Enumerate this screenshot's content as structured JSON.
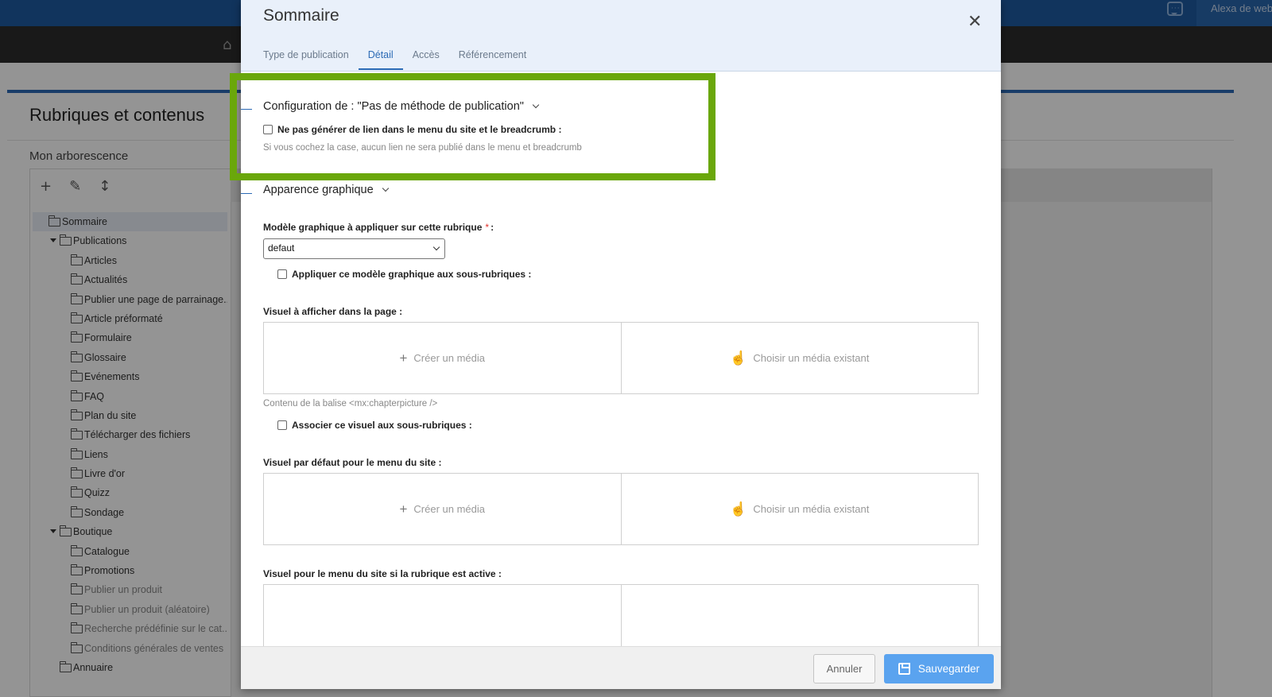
{
  "background": {
    "user_label": "Alexa de web",
    "page_title": "Rubriques et contenus",
    "tree_title": "Mon arborescence",
    "toolbar_icons": [
      "plus-icon",
      "pencil-icon",
      "move-icon"
    ],
    "tree": [
      {
        "label": "Sommaire",
        "level": 0,
        "selected": true,
        "expanded": false,
        "dim": false
      },
      {
        "label": "Publications",
        "level": 1,
        "expanded": true,
        "dim": false
      },
      {
        "label": "Articles",
        "level": 2,
        "dim": false
      },
      {
        "label": "Actualités",
        "level": 2,
        "dim": false
      },
      {
        "label": "Publier une page de parrainage...",
        "level": 2,
        "dim": false
      },
      {
        "label": "Article préformaté",
        "level": 2,
        "dim": false
      },
      {
        "label": "Formulaire",
        "level": 2,
        "dim": false
      },
      {
        "label": "Glossaire",
        "level": 2,
        "dim": false
      },
      {
        "label": "Evénements",
        "level": 2,
        "dim": false
      },
      {
        "label": "FAQ",
        "level": 2,
        "dim": false
      },
      {
        "label": "Plan du site",
        "level": 2,
        "dim": false
      },
      {
        "label": "Télécharger des fichiers",
        "level": 2,
        "dim": false
      },
      {
        "label": "Liens",
        "level": 2,
        "dim": false
      },
      {
        "label": "Livre d'or",
        "level": 2,
        "dim": false
      },
      {
        "label": "Quizz",
        "level": 2,
        "dim": false
      },
      {
        "label": "Sondage",
        "level": 2,
        "dim": false
      },
      {
        "label": "Boutique",
        "level": 1,
        "expanded": true,
        "dim": false
      },
      {
        "label": "Catalogue",
        "level": 2,
        "dim": false
      },
      {
        "label": "Promotions",
        "level": 2,
        "dim": false
      },
      {
        "label": "Publier un produit",
        "level": 2,
        "dim": true
      },
      {
        "label": "Publier un produit (aléatoire)",
        "level": 2,
        "dim": true
      },
      {
        "label": "Recherche prédéfinie sur le cat...",
        "level": 2,
        "dim": true
      },
      {
        "label": "Conditions générales de ventes",
        "level": 2,
        "dim": true
      },
      {
        "label": "Annuaire",
        "level": 1,
        "dim": false
      }
    ]
  },
  "modal": {
    "title": "Sommaire",
    "close_icon": "close-icon",
    "tabs": [
      {
        "label": "Type de publication",
        "active": false
      },
      {
        "label": "Détail",
        "active": true
      },
      {
        "label": "Accès",
        "active": false
      },
      {
        "label": "Référencement",
        "active": false
      }
    ],
    "config_section": {
      "title": "Configuration de : \"Pas de méthode de publication\"",
      "checkbox_label": "Ne pas générer de lien dans le menu du site et le breadcrumb :",
      "help": "Si vous cochez la case, aucun lien ne sera publié dans le menu et breadcrumb"
    },
    "appearance_section": {
      "title": "Apparence graphique",
      "model_label": "Modèle graphique à appliquer sur cette rubrique",
      "model_required": "*",
      "model_colon": ":",
      "model_value": "defaut",
      "apply_sub_label": "Appliquer ce modèle graphique aux sous-rubriques :",
      "visual_page_label": "Visuel à afficher dans la page :",
      "create_media": "Créer un média",
      "choose_media": "Choisir un média existant",
      "tag_help": "Contenu de la balise <mx:chapterpicture />",
      "associate_sub_label": "Associer ce visuel aux sous-rubriques :",
      "visual_menu_label": "Visuel par défaut pour le menu du site :",
      "visual_active_label": "Visuel pour le menu du site si la rubrique est active :"
    },
    "footer": {
      "cancel_label": "Annuler",
      "save_label": "Sauvegarder"
    }
  },
  "colors": {
    "accent": "#2b6ab5",
    "highlight": "#6aa70b",
    "save_button": "#5aa3ef",
    "required": "#e0312b"
  }
}
